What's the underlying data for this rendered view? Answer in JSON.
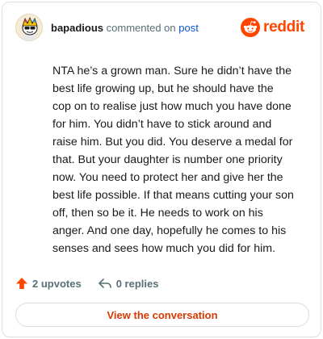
{
  "comment_header": {
    "username": "bapadious",
    "action_text": "commented on",
    "post_link_text": "post"
  },
  "brand": {
    "name": "reddit",
    "icon": "reddit-logo-icon",
    "color": "#ff4500"
  },
  "avatar": {
    "icon": "snoo-avatar-icon"
  },
  "comment": {
    "body": "NTA he’s a grown man. Sure he didn’t have the best life growing up, but he should have the cop on to realise just how much you have done for him. You didn’t have to stick around and raise him. But you did. You deserve a medal for that. But your daughter is number one priority now. You need to protect her and give her the best life possible. If that means cutting your son off, then so be it. He needs to work on his anger. And one day, hopefully he comes to his senses and sees how much you did for him."
  },
  "stats": {
    "upvotes": "2 upvotes",
    "upvote_icon": "upvote-arrow-icon",
    "replies": "0 replies",
    "reply_icon": "reply-arrow-icon"
  },
  "cta": {
    "label": "View the conversation",
    "color": "#d93900"
  },
  "colors": {
    "accent": "#ff4500",
    "link": "#0a57c9",
    "muted": "#576f76"
  }
}
